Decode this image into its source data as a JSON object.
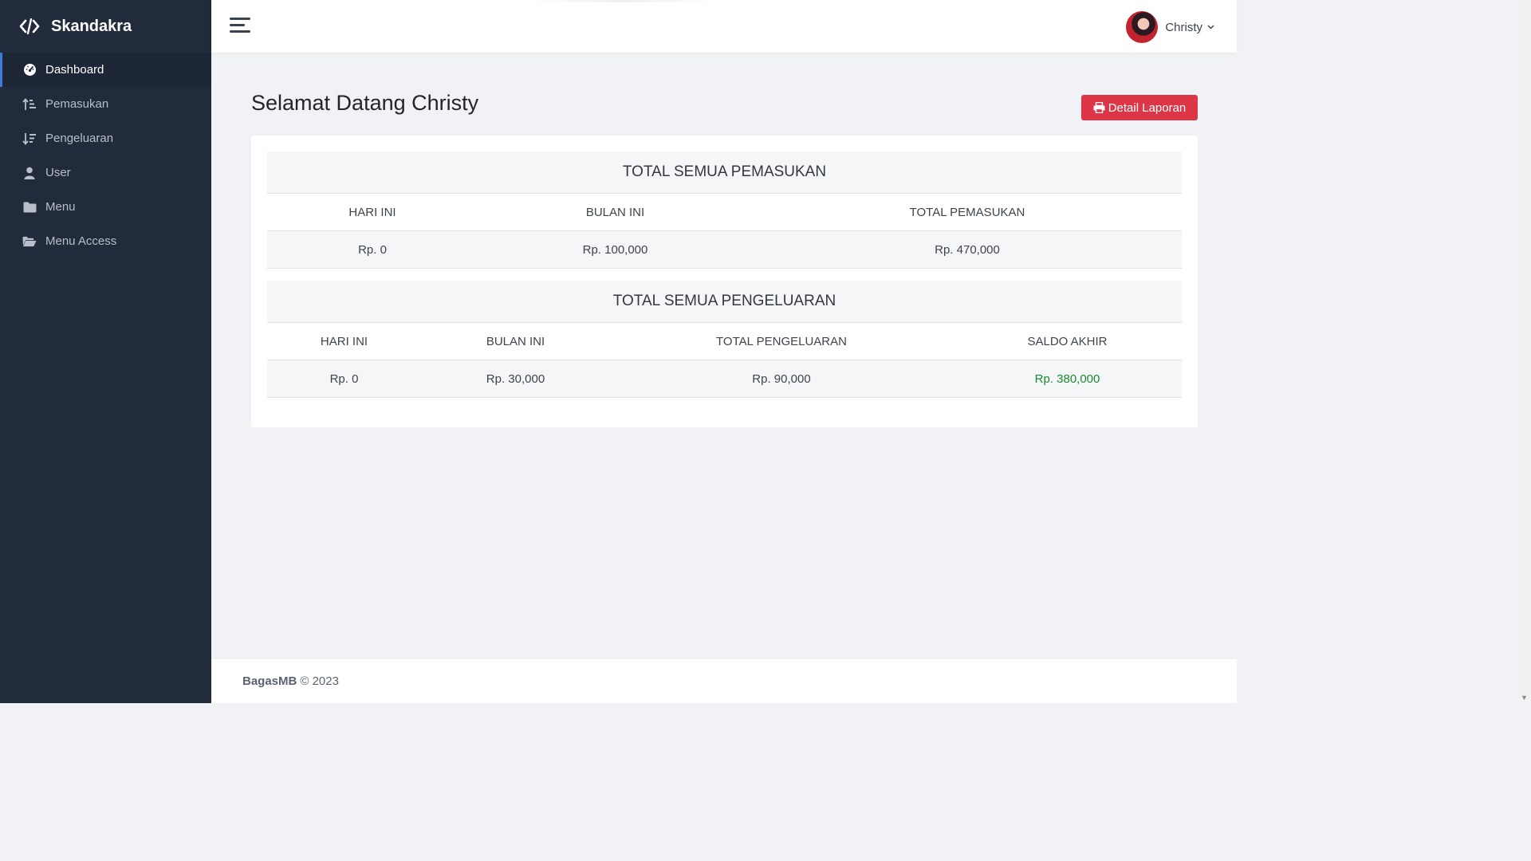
{
  "brand": {
    "name": "Skandakra",
    "icon": "code-icon"
  },
  "sidebar": {
    "items": [
      {
        "label": "Dashboard",
        "icon": "tachometer-icon",
        "active": true
      },
      {
        "label": "Pemasukan",
        "icon": "sort-amount-up-icon",
        "active": false
      },
      {
        "label": "Pengeluaran",
        "icon": "sort-amount-down-icon",
        "active": false
      },
      {
        "label": "User",
        "icon": "user-icon",
        "active": false
      },
      {
        "label": "Menu",
        "icon": "folder-icon",
        "active": false
      },
      {
        "label": "Menu Access",
        "icon": "folder-open-icon",
        "active": false
      }
    ]
  },
  "topbar": {
    "user_name": "Christy"
  },
  "main": {
    "title": "Selamat Datang Christy",
    "report_button": "Detail Laporan"
  },
  "income": {
    "heading": "TOTAL SEMUA PEMASUKAN",
    "columns": [
      "HARI INI",
      "BULAN INI",
      "TOTAL PEMASUKAN"
    ],
    "values": [
      "Rp. 0",
      "Rp. 100,000",
      "Rp. 470,000"
    ]
  },
  "expense": {
    "heading": "TOTAL SEMUA PENGELUARAN",
    "columns": [
      "HARI INI",
      "BULAN INI",
      "TOTAL PENGELUARAN",
      "SALDO AKHIR"
    ],
    "values": [
      "Rp. 0",
      "Rp. 30,000",
      "Rp. 90,000",
      "Rp. 380,000"
    ]
  },
  "footer": {
    "author": "BagasMB",
    "text": "© 2023"
  },
  "colors": {
    "sidebar": "#212b3b",
    "accent_active": "#3e7bd6",
    "button_danger": "#dc3545",
    "balance_green": "#198a2f"
  }
}
